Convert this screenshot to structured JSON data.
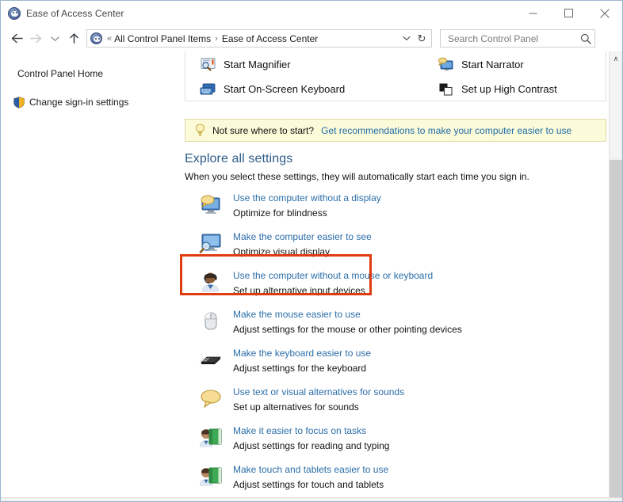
{
  "window": {
    "title": "Ease of Access Center",
    "app_icon": "ease-of-access-icon",
    "minimize_label": "Minimize",
    "maximize_label": "Maximize",
    "close_label": "Close"
  },
  "addressbar": {
    "back_label": "Back",
    "forward_label": "Forward",
    "recent_label": "Recent locations",
    "up_label": "Up",
    "crumb_overflow": "«",
    "crumbs": [
      {
        "label": "All Control Panel Items"
      },
      {
        "label": "Ease of Access Center"
      }
    ],
    "separator": "›",
    "dropdown": "∨",
    "refresh": "↻",
    "search": {
      "placeholder": "Search Control Panel",
      "value": "",
      "icon": "search-icon"
    }
  },
  "nav_pane": {
    "items": [
      {
        "label": "Control Panel Home",
        "icon": null
      },
      {
        "label": "Change sign-in settings",
        "icon": "shield-icon"
      }
    ]
  },
  "quick_access": {
    "items": [
      {
        "label": "Start Magnifier",
        "icon": "magnifier-icon"
      },
      {
        "label": "Start Narrator",
        "icon": "narrator-icon"
      },
      {
        "label": "Start On-Screen Keyboard",
        "icon": "on-screen-keyboard-icon"
      },
      {
        "label": "Set up High Contrast",
        "icon": "high-contrast-icon"
      }
    ]
  },
  "banner": {
    "icon": "lightbulb-icon",
    "text": "Not sure where to start?",
    "link": "Get recommendations to make your computer easier to use"
  },
  "explore": {
    "title": "Explore all settings",
    "subtitle": "When you select these settings, they will automatically start each time you sign in."
  },
  "settings": [
    {
      "link": "Use the computer without a display",
      "desc": "Optimize for blindness",
      "icon": "display-speech-icon",
      "highlighted": false
    },
    {
      "link": "Make the computer easier to see",
      "desc": "Optimize visual display",
      "icon": "monitor-magnify-icon",
      "highlighted": false
    },
    {
      "link": "Use the computer without a mouse or keyboard",
      "desc": "Set up alternative input devices",
      "icon": "person-headset-icon",
      "highlighted": false
    },
    {
      "link": "Make the mouse easier to use",
      "desc": "Adjust settings for the mouse or other pointing devices",
      "icon": "mouse-icon",
      "highlighted": false
    },
    {
      "link": "Make the keyboard easier to use",
      "desc": "Adjust settings for the keyboard",
      "icon": "keyboard-icon",
      "highlighted": true
    },
    {
      "link": "Use text or visual alternatives for sounds",
      "desc": "Set up alternatives for sounds",
      "icon": "speech-bubble-icon",
      "highlighted": false
    },
    {
      "link": "Make it easier to focus on tasks",
      "desc": "Adjust settings for reading and typing",
      "icon": "person-book-icon",
      "highlighted": false
    },
    {
      "link": "Make touch and tablets easier to use",
      "desc": "Adjust settings for touch and tablets",
      "icon": "person-book-icon",
      "highlighted": false
    }
  ],
  "scrollbar": {
    "up_arrow": "∧"
  },
  "colors": {
    "link": "#2b6ea8",
    "heading": "#2d5c88",
    "highlight_border": "#e03c10",
    "banner_bg": "#fcfbd9",
    "banner_border": "#ded9a6"
  }
}
